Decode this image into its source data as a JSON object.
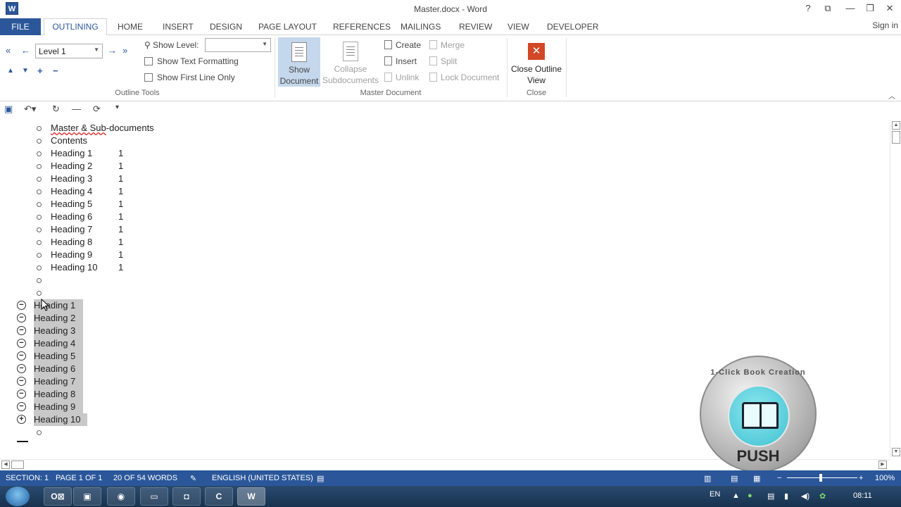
{
  "window": {
    "title": "Master.docx - Word",
    "app_icon": "W",
    "buttons": [
      "?",
      "restore-ribbon-icon",
      "minimize-icon",
      "restore-icon",
      "close-icon"
    ]
  },
  "tabs": {
    "file": "FILE",
    "active": "OUTLINING",
    "items": [
      "HOME",
      "INSERT",
      "DESIGN",
      "PAGE LAYOUT",
      "REFERENCES",
      "MAILINGS",
      "REVIEW",
      "VIEW",
      "DEVELOPER"
    ],
    "signin": "Sign in"
  },
  "ribbon": {
    "outline_tools": {
      "label": "Outline Tools",
      "level_value": "Level 1",
      "show_level_label": "Show Level:",
      "show_level_value": "",
      "show_text_formatting": "Show Text Formatting",
      "show_first_line_only": "Show First Line Only"
    },
    "master_document": {
      "label": "Master Document",
      "show_document": "Show Document",
      "collapse_subdocuments": "Collapse Subdocuments",
      "create": "Create",
      "insert": "Insert",
      "unlink": "Unlink",
      "merge": "Merge",
      "split": "Split",
      "lock_document": "Lock Document"
    },
    "close": {
      "label": "Close",
      "close_outline_view": "Close Outline View"
    }
  },
  "document": {
    "title_line": "Master & Sub-documents",
    "contents_label": "Contents",
    "toc": [
      {
        "heading": "Heading 1",
        "page": "1"
      },
      {
        "heading": "Heading 2",
        "page": "1"
      },
      {
        "heading": "Heading 3",
        "page": "1"
      },
      {
        "heading": "Heading 4",
        "page": "1"
      },
      {
        "heading": "Heading 5",
        "page": "1"
      },
      {
        "heading": "Heading 6",
        "page": "1"
      },
      {
        "heading": "Heading 7",
        "page": "1"
      },
      {
        "heading": "Heading 8",
        "page": "1"
      },
      {
        "heading": "Heading 9",
        "page": "1"
      },
      {
        "heading": "Heading 10",
        "page": "1"
      }
    ],
    "headings": [
      {
        "text": "Heading 1",
        "expanded": true
      },
      {
        "text": "Heading 2",
        "expanded": true
      },
      {
        "text": "Heading 3",
        "expanded": true
      },
      {
        "text": "Heading 4",
        "expanded": true
      },
      {
        "text": "Heading 5",
        "expanded": true
      },
      {
        "text": "Heading 6",
        "expanded": true
      },
      {
        "text": "Heading 7",
        "expanded": true
      },
      {
        "text": "Heading 8",
        "expanded": true
      },
      {
        "text": "Heading 9",
        "expanded": true
      },
      {
        "text": "Heading 10",
        "expanded": false
      }
    ]
  },
  "status": {
    "section": "SECTION: 1",
    "page": "PAGE 1 OF 1",
    "words": "20 OF 54 WORDS",
    "language": "ENGLISH (UNITED STATES)",
    "zoom": "100%",
    "zoom_minus": "−",
    "zoom_plus": "+"
  },
  "taskbar": {
    "lang": "EN",
    "time": "08:11"
  },
  "watermark": {
    "ring_text": "1-Click Book Creation",
    "push": "PUSH"
  },
  "colors": {
    "accent": "#2b579a",
    "selection": "#c8c8c8",
    "close_icon": "#d24726"
  }
}
